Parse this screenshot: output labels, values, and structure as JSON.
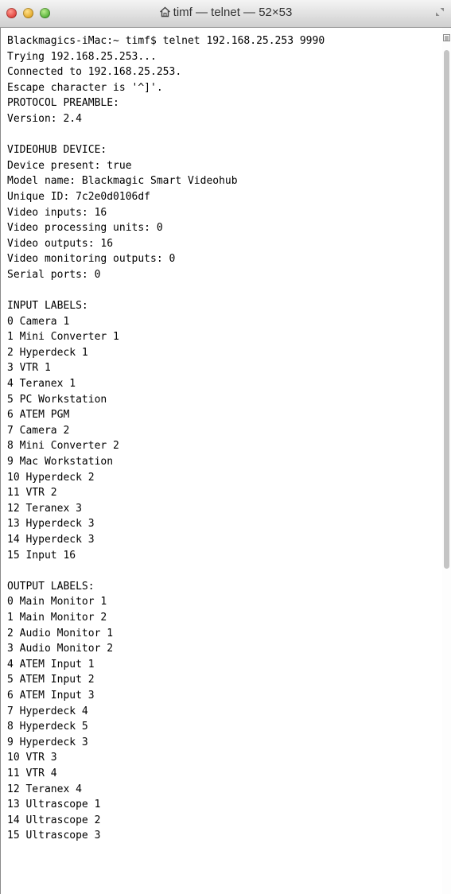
{
  "window": {
    "title": "timf — telnet — 52×53"
  },
  "terminal": {
    "lines": [
      "Blackmagics-iMac:~ timf$ telnet 192.168.25.253 9990",
      "Trying 192.168.25.253...",
      "Connected to 192.168.25.253.",
      "Escape character is '^]'.",
      "PROTOCOL PREAMBLE:",
      "Version: 2.4",
      "",
      "VIDEOHUB DEVICE:",
      "Device present: true",
      "Model name: Blackmagic Smart Videohub",
      "Unique ID: 7c2e0d0106df",
      "Video inputs: 16",
      "Video processing units: 0",
      "Video outputs: 16",
      "Video monitoring outputs: 0",
      "Serial ports: 0",
      "",
      "INPUT LABELS:",
      "0 Camera 1",
      "1 Mini Converter 1",
      "2 Hyperdeck 1",
      "3 VTR 1",
      "4 Teranex 1",
      "5 PC Workstation",
      "6 ATEM PGM",
      "7 Camera 2",
      "8 Mini Converter 2",
      "9 Mac Workstation",
      "10 Hyperdeck 2",
      "11 VTR 2",
      "12 Teranex 3",
      "13 Hyperdeck 3",
      "14 Hyperdeck 3",
      "15 Input 16",
      "",
      "OUTPUT LABELS:",
      "0 Main Monitor 1",
      "1 Main Monitor 2",
      "2 Audio Monitor 1",
      "3 Audio Monitor 2",
      "4 ATEM Input 1",
      "5 ATEM Input 2",
      "6 ATEM Input 3",
      "7 Hyperdeck 4",
      "8 Hyperdeck 5",
      "9 Hyperdeck 3",
      "10 VTR 3",
      "11 VTR 4",
      "12 Teranex 4",
      "13 Ultrascope 1",
      "14 Ultrascope 2",
      "15 Ultrascope 3",
      ""
    ]
  },
  "icons": {
    "title": "home-icon",
    "resize": "fullscreen-icon",
    "scroll": "scroll-marker-icon"
  }
}
